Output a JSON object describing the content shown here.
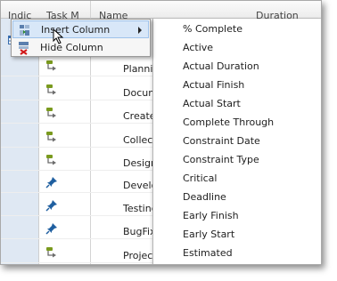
{
  "grid": {
    "headers": [
      "Indic",
      "Task M",
      "Name",
      "Duration"
    ],
    "rows": [
      {
        "name": "Planning",
        "mode": "auto"
      },
      {
        "name": "Docum",
        "mode": "auto"
      },
      {
        "name": "Create/",
        "mode": "auto"
      },
      {
        "name": "Collect",
        "mode": "auto"
      },
      {
        "name": "Design",
        "mode": "auto"
      },
      {
        "name": "Develo",
        "mode": "manual"
      },
      {
        "name": "Testing",
        "mode": "manual"
      },
      {
        "name": "BugFix",
        "mode": "manual"
      },
      {
        "name": "Project",
        "mode": "auto"
      }
    ]
  },
  "context_menu": {
    "items": [
      {
        "label": "Insert Column",
        "icon": "insert-column-icon",
        "has_submenu": true,
        "highlighted": true
      },
      {
        "label": "Hide Column",
        "icon": "hide-column-icon",
        "has_submenu": false,
        "highlighted": false
      }
    ]
  },
  "submenu": {
    "items": [
      "% Complete",
      "Active",
      "Actual Duration",
      "Actual Finish",
      "Actual Start",
      "Complete Through",
      "Constraint Date",
      "Constraint Type",
      "Critical",
      "Deadline",
      "Early Finish",
      "Early Start",
      "Estimated"
    ]
  },
  "colors": {
    "accent_highlight": "#d8e7f8",
    "indicator_column": "#dfe8f3",
    "auto_task_icon": "#7a9a1e",
    "manual_task_icon": "#1f5fa0"
  }
}
